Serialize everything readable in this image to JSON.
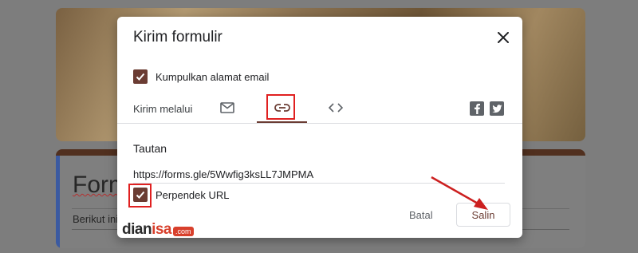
{
  "background": {
    "form_title": "Form",
    "form_description": "Berikut ini"
  },
  "dialog": {
    "title": "Kirim formulir",
    "collect_email": {
      "label": "Kumpulkan alamat email",
      "checked": true
    },
    "send_via_label": "Kirim melalui",
    "tabs": [
      {
        "name": "email",
        "icon": "mail-icon",
        "selected": false
      },
      {
        "name": "link",
        "icon": "link-icon",
        "selected": true
      },
      {
        "name": "embed",
        "icon": "code-icon",
        "selected": false
      }
    ],
    "social": [
      "facebook-icon",
      "twitter-icon"
    ],
    "section_title": "Tautan",
    "url_value": "https://forms.gle/5Wwfig3ksLL7JMPMA",
    "shorten": {
      "label": "Perpendek URL",
      "checked": true
    },
    "cancel_label": "Batal",
    "copy_label": "Salin"
  },
  "watermark": {
    "brand_prefix": "dian",
    "brand_accent": "isa",
    "brand_domain": ".com"
  },
  "colors": {
    "accent": "#6b3c33",
    "highlight": "#e02020",
    "arrow": "#cc1f1f",
    "watermark_accent": "#d8402c",
    "form_left_border": "#3b5aa1"
  }
}
